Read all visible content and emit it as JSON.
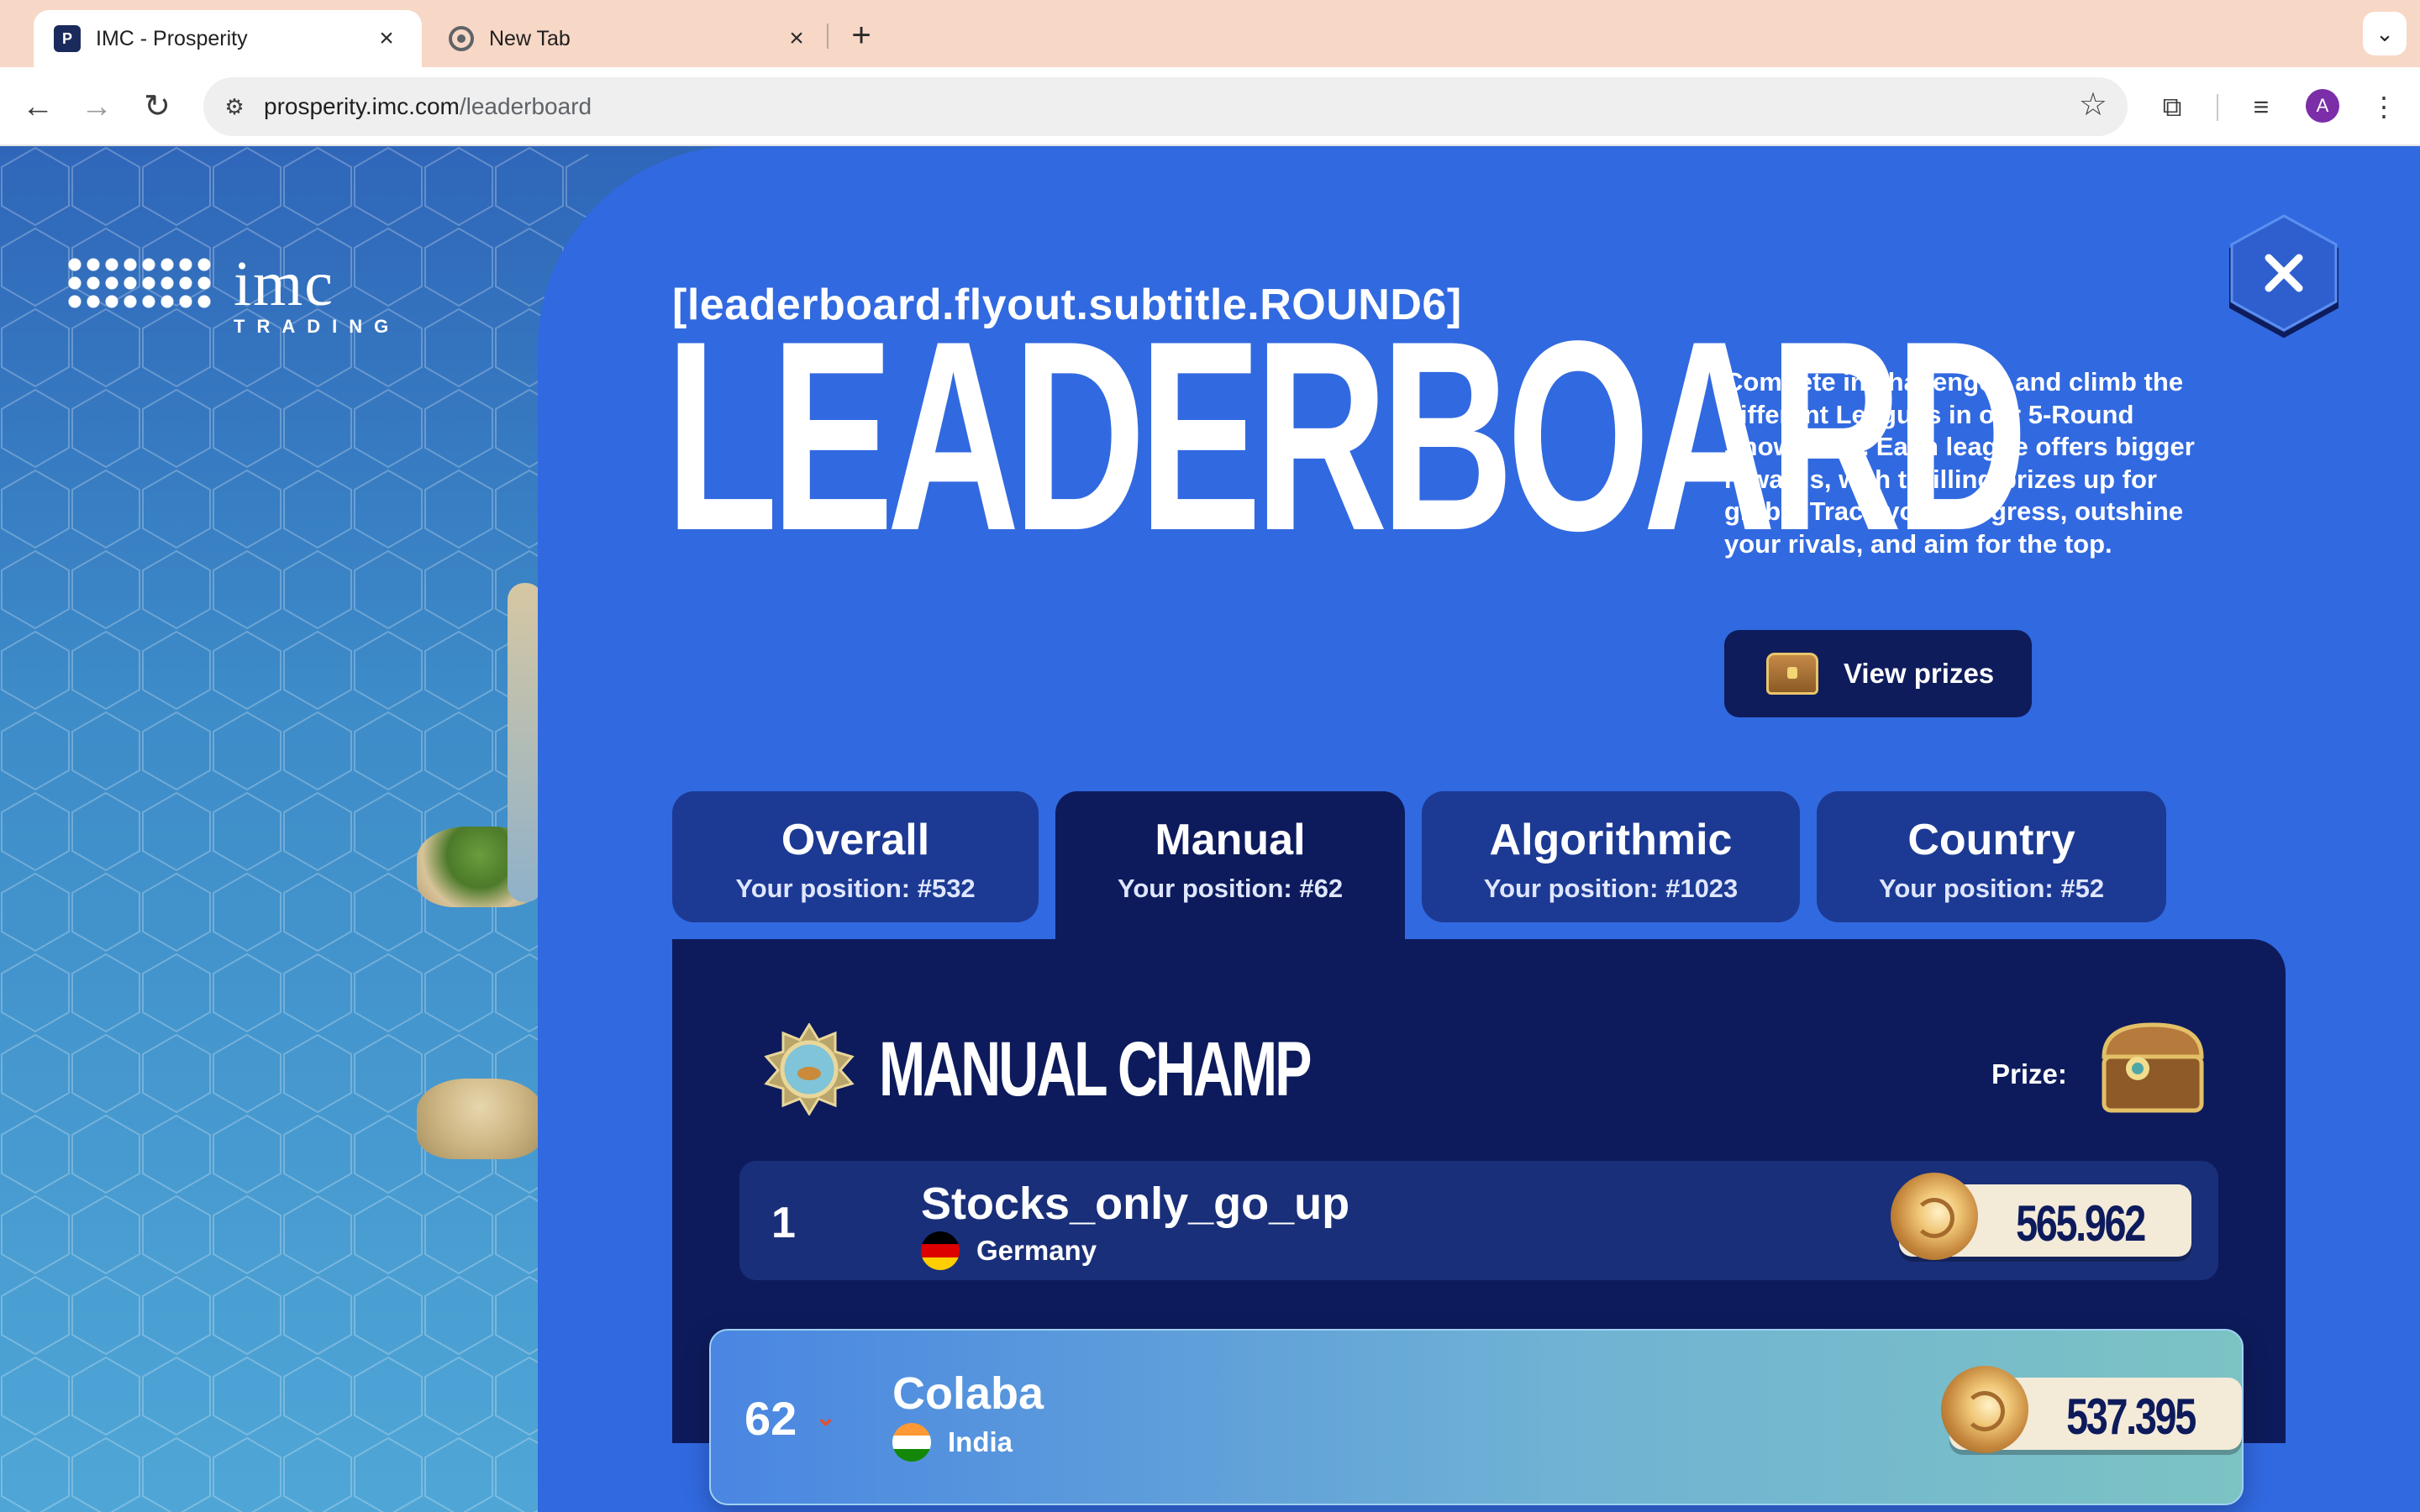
{
  "browser": {
    "tabs": [
      {
        "title": "IMC - Prosperity",
        "active": true
      },
      {
        "title": "New Tab",
        "active": false
      }
    ],
    "new_tab_symbol": "+",
    "url_host": "prosperity.imc.com",
    "url_path": "/leaderboard",
    "profile_initial": "A"
  },
  "brand": {
    "logo_text": "imc",
    "logo_sub": "TRADING"
  },
  "header": {
    "subtitle": "[leaderboard.flyout.subtitle.ROUND6]",
    "title": "LEADERBOARD",
    "description": "Compete in challenges and climb the different Leagues in our 5-Round Showdown. Each league offers bigger rewards, with thrilling prizes up for grabs. Track your progress, outshine your rivals, and aim for the top.",
    "view_prizes_label": "View prizes"
  },
  "tabs": [
    {
      "name": "Overall",
      "position": "Your position: #532",
      "active": false
    },
    {
      "name": "Manual",
      "position": "Your position: #62",
      "active": true
    },
    {
      "name": "Algorithmic",
      "position": "Your position: #1023",
      "active": false
    },
    {
      "name": "Country",
      "position": "Your position: #52",
      "active": false
    }
  ],
  "board": {
    "title": "MANUAL CHAMP",
    "prize_label": "Prize:",
    "rows": [
      {
        "rank": "1",
        "name": "Stocks_only_go_up",
        "country": "Germany",
        "score": "565.962"
      }
    ],
    "you": {
      "rank": "62",
      "trend": "down",
      "name": "Colaba",
      "country": "India",
      "score": "537.395"
    }
  },
  "colors": {
    "panel": "#3169e0",
    "board": "#0d1b5c",
    "accent_down": "#e0502f"
  }
}
